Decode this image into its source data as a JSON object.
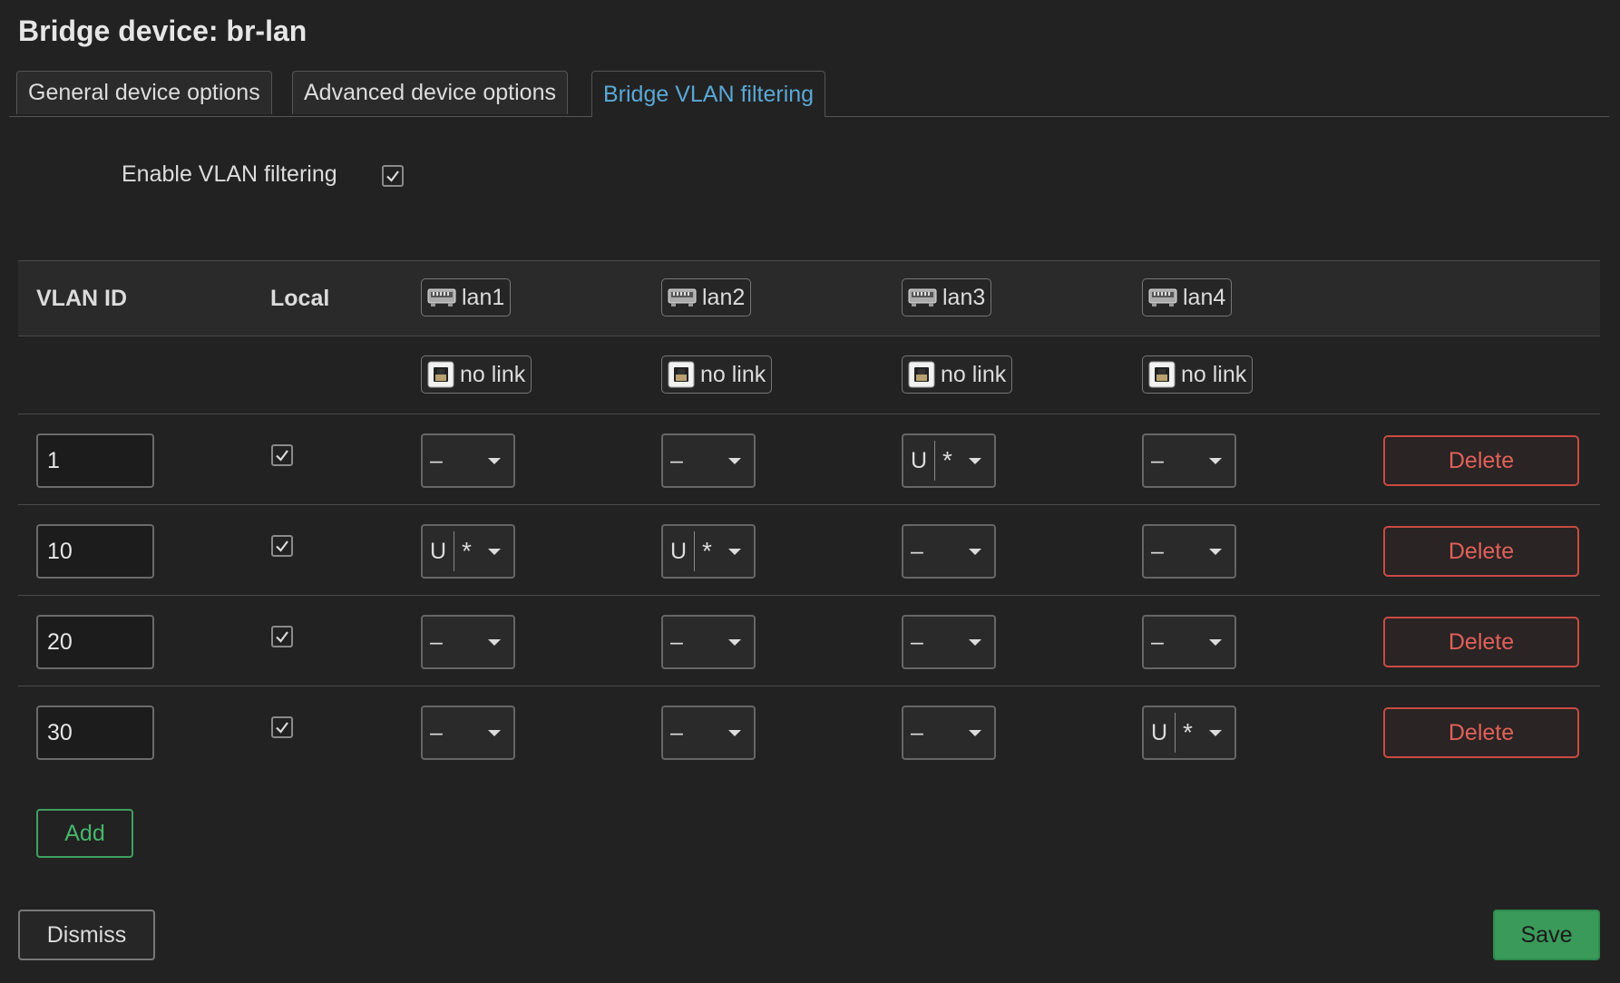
{
  "dialog": {
    "title": "Bridge device: br-lan"
  },
  "tabs": [
    {
      "label": "General device options",
      "active": false
    },
    {
      "label": "Advanced device options",
      "active": false
    },
    {
      "label": "Bridge VLAN filtering",
      "active": true
    }
  ],
  "options": {
    "enable_vlan_filtering_label": "Enable VLAN filtering",
    "enable_vlan_filtering": true
  },
  "table": {
    "col_vlan_id": "VLAN ID",
    "col_local": "Local",
    "ports": [
      {
        "name": "lan1",
        "status": "no link"
      },
      {
        "name": "lan2",
        "status": "no link"
      },
      {
        "name": "lan3",
        "status": "no link"
      },
      {
        "name": "lan4",
        "status": "no link"
      }
    ],
    "rows": [
      {
        "vlan_id": "1",
        "local": true,
        "ports": [
          {
            "u": "–",
            "t": ""
          },
          {
            "u": "–",
            "t": ""
          },
          {
            "u": "U",
            "t": "*"
          },
          {
            "u": "–",
            "t": ""
          }
        ],
        "delete_label": "Delete"
      },
      {
        "vlan_id": "10",
        "local": true,
        "ports": [
          {
            "u": "U",
            "t": "*"
          },
          {
            "u": "U",
            "t": "*"
          },
          {
            "u": "–",
            "t": ""
          },
          {
            "u": "–",
            "t": ""
          }
        ],
        "delete_label": "Delete"
      },
      {
        "vlan_id": "20",
        "local": true,
        "ports": [
          {
            "u": "–",
            "t": ""
          },
          {
            "u": "–",
            "t": ""
          },
          {
            "u": "–",
            "t": ""
          },
          {
            "u": "–",
            "t": ""
          }
        ],
        "delete_label": "Delete"
      },
      {
        "vlan_id": "30",
        "local": true,
        "ports": [
          {
            "u": "–",
            "t": ""
          },
          {
            "u": "–",
            "t": ""
          },
          {
            "u": "–",
            "t": ""
          },
          {
            "u": "U",
            "t": "*"
          }
        ],
        "delete_label": "Delete"
      }
    ]
  },
  "buttons": {
    "add": "Add",
    "dismiss": "Dismiss",
    "save": "Save"
  },
  "colors": {
    "accent_tab": "#5aa8d6",
    "delete": "#e0605a",
    "add": "#48b56c",
    "save": "#3a9a5a"
  }
}
